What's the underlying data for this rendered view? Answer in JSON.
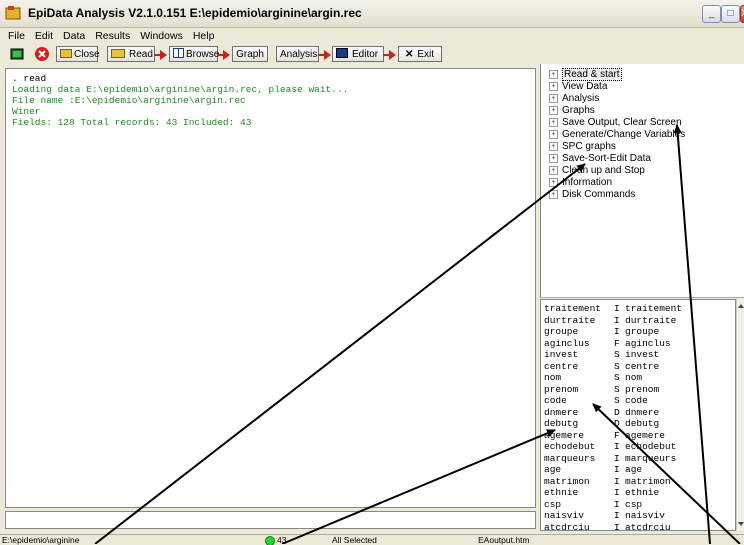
{
  "window": {
    "title": "EpiData Analysis V2.1.0.151  E:\\epidemio\\arginine\\argin.rec",
    "minimize": "_",
    "maximize": "□",
    "close": "X"
  },
  "menu": [
    "File",
    "Edit",
    "Data",
    "Results",
    "Windows",
    "Help"
  ],
  "toolbar": {
    "close_label": "Close",
    "read_label": "Read",
    "browse_label": "Browse",
    "graph_label": "Graph",
    "analysis_label": "Analysis",
    "editor_label": "Editor",
    "exit_label": "Exit"
  },
  "output": {
    "command": ". read",
    "lines": [
      "Loading data E:\\epidemio\\arginine\\argin.rec, please wait...",
      "File name :E:\\epidemio\\arginine\\argin.rec",
      "Winer",
      "Fields: 128 Total records: 43 Included: 43"
    ]
  },
  "tree": [
    "Read & start",
    "View Data",
    "Analysis",
    "Graphs",
    "Save Output, Clear Screen",
    "Generate/Change Variables",
    "SPC graphs",
    "Save-Sort-Edit Data",
    "Clean up and Stop",
    "Information",
    "Disk Commands"
  ],
  "variables": [
    [
      "traitement",
      "I",
      "traitement"
    ],
    [
      "durtraite",
      "I",
      "durtraite"
    ],
    [
      "groupe",
      "I",
      "groupe"
    ],
    [
      "aginclus",
      "F",
      "aginclus"
    ],
    [
      "invest",
      "S",
      "invest"
    ],
    [
      "centre",
      "S",
      "centre"
    ],
    [
      "nom",
      "S",
      "nom"
    ],
    [
      "prenom",
      "S",
      "prenom"
    ],
    [
      "code",
      "S",
      "code"
    ],
    [
      "dnmere",
      "D",
      "dnmere"
    ],
    [
      "debutg",
      "D",
      "debutg"
    ],
    [
      "agemere",
      "F",
      "agemere"
    ],
    [
      "echodebut",
      "I",
      "echodebut"
    ],
    [
      "marqueurs",
      "I",
      "marqueurs"
    ],
    [
      "age",
      "I",
      "age"
    ],
    [
      "matrimon",
      "I",
      "matrimon"
    ],
    [
      "ethnie",
      "I",
      "ethnie"
    ],
    [
      "csp",
      "I",
      "csp"
    ],
    [
      "naisviv",
      "I",
      "naisviv"
    ],
    [
      "atcdrciu",
      "I",
      "atcdrciu"
    ]
  ],
  "status": {
    "path": "E:\\epidemio\\arginine",
    "records": "43",
    "selection": "All Selected",
    "output_file": "EAoutput.htm"
  }
}
